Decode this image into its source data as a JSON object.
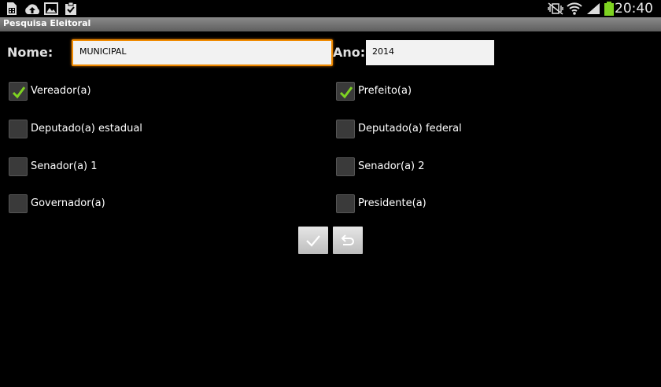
{
  "status_bar": {
    "time": "20:40",
    "icons": [
      "sim-card-icon",
      "cloud-upload-icon",
      "image-icon",
      "clipboard-check-icon",
      "vibrate-mute-icon",
      "wifi-icon",
      "signal-icon",
      "battery-icon"
    ]
  },
  "app": {
    "title": "Pesquisa Eleitoral"
  },
  "form": {
    "nome_label": "Nome:",
    "nome_value": "MUNICIPAL",
    "ano_label": "Ano:",
    "ano_value": "2014"
  },
  "options": {
    "vereador": {
      "label": "Vereador(a)",
      "checked": true
    },
    "prefeito": {
      "label": "Prefeito(a)",
      "checked": true
    },
    "dep_estadual": {
      "label": "Deputado(a) estadual",
      "checked": false
    },
    "dep_federal": {
      "label": "Deputado(a) federal",
      "checked": false
    },
    "senador1": {
      "label": "Senador(a) 1",
      "checked": false
    },
    "senador2": {
      "label": "Senador(a) 2",
      "checked": false
    },
    "governador": {
      "label": "Governador(a)",
      "checked": false
    },
    "presidente": {
      "label": "Presidente(a)",
      "checked": false
    }
  },
  "buttons": {
    "confirm_icon": "checkmark-icon",
    "back_icon": "undo-icon"
  },
  "colors": {
    "check": "#7ed321",
    "focus_border": "#f08a00"
  }
}
